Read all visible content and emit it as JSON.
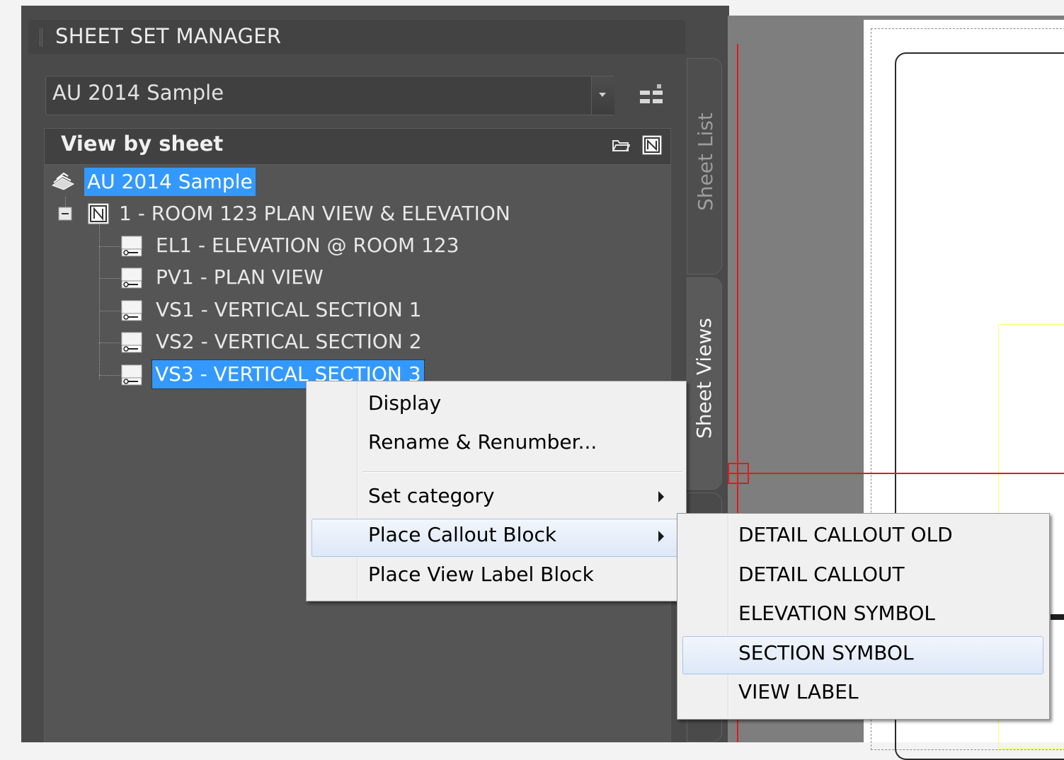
{
  "palette": {
    "title": "SHEET SET MANAGER",
    "sheet_set_selector": {
      "value": "AU 2014 Sample"
    },
    "view_mode_header": "View by sheet"
  },
  "tree": {
    "root": {
      "label": "AU 2014 Sample",
      "selected": true
    },
    "sheet": {
      "label": "1 - ROOM 123 PLAN VIEW & ELEVATION",
      "expanded": true
    },
    "views": [
      {
        "label": "EL1 - ELEVATION @ ROOM 123"
      },
      {
        "label": "PV1 - PLAN VIEW"
      },
      {
        "label": "VS1 - VERTICAL SECTION 1"
      },
      {
        "label": "VS2 - VERTICAL SECTION 2"
      },
      {
        "label": "VS3 - VERTICAL SECTION 3",
        "selected": true
      }
    ]
  },
  "side_tabs": {
    "sheet_list": "Sheet List",
    "sheet_views": "Sheet Views",
    "active": "Sheet Views"
  },
  "context_menu": {
    "items": [
      {
        "label": "Display"
      },
      {
        "label": "Rename & Renumber..."
      },
      {
        "label": "Set category",
        "has_submenu": true
      },
      {
        "label": "Place Callout Block",
        "has_submenu": true,
        "highlighted": true
      },
      {
        "label": "Place View Label Block"
      }
    ]
  },
  "submenu": {
    "items": [
      {
        "label": "DETAIL CALLOUT OLD"
      },
      {
        "label": "DETAIL CALLOUT"
      },
      {
        "label": "ELEVATION SYMBOL"
      },
      {
        "label": "SECTION SYMBOL",
        "highlighted": true
      },
      {
        "label": "VIEW LABEL"
      }
    ]
  },
  "colors": {
    "selection": "#3399ff",
    "palette_bg": "#4a4a4a",
    "crosshair": "#e11b1b",
    "menu_bg": "#f0f0f0",
    "menu_highlight_border": "#a9c4ea"
  }
}
